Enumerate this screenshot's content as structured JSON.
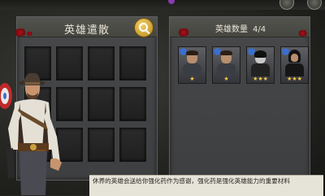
{
  "left_panel": {
    "title": "英雄遣散",
    "slot_count": 12,
    "search_icon": "search-icon"
  },
  "right_panel": {
    "title": "英雄数量",
    "count": "4/4",
    "heroes": [
      {
        "name": "hero-portrait-1",
        "stars": "★"
      },
      {
        "name": "hero-portrait-2",
        "stars": "★"
      },
      {
        "name": "hero-portrait-3",
        "stars": "★★★"
      },
      {
        "name": "hero-portrait-4",
        "stars": "★★★"
      }
    ]
  },
  "info": {
    "text": "休养的英雄会送给你强化药作为感谢，强化药是强化英雄能力的重要材料"
  },
  "colors": {
    "accent": "#f3d16a",
    "blood": "#a8121a"
  }
}
